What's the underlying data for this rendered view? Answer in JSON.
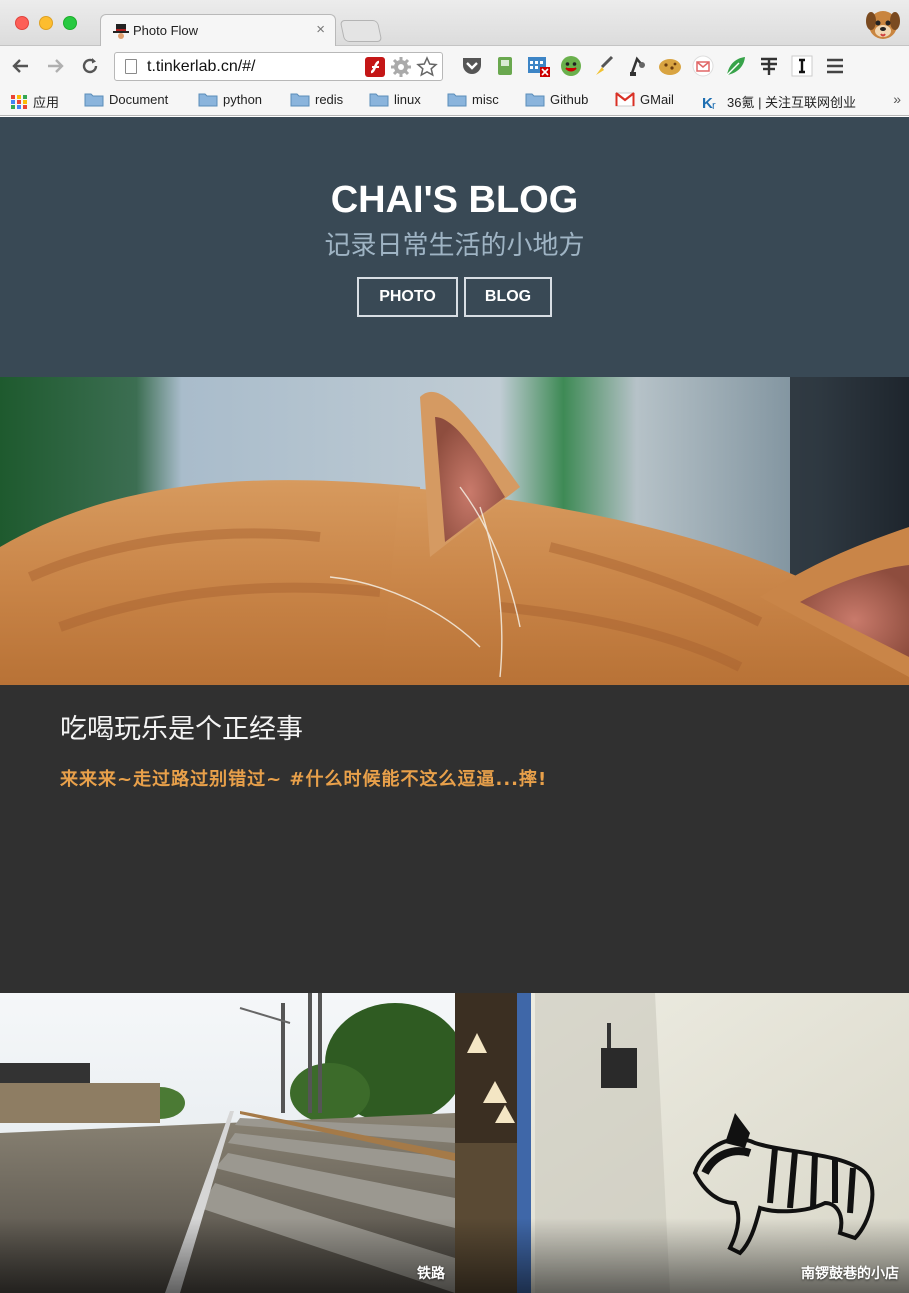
{
  "browser": {
    "tab_title": "Photo Flow",
    "tab_close": "×",
    "url": "t.tinkerlab.cn/#/",
    "bookmarks": [
      {
        "label": "应用",
        "icon": "apps-grid-icon"
      },
      {
        "label": "Document",
        "icon": "folder-icon"
      },
      {
        "label": "python",
        "icon": "folder-icon"
      },
      {
        "label": "redis",
        "icon": "folder-icon"
      },
      {
        "label": "linux",
        "icon": "folder-icon"
      },
      {
        "label": "misc",
        "icon": "folder-icon"
      },
      {
        "label": "Github",
        "icon": "folder-icon"
      },
      {
        "label": "GMail",
        "icon": "gmail-icon"
      },
      {
        "label": "36氪 | 关注互联网创业",
        "icon": "kr-icon"
      }
    ],
    "bookmarks_overflow": "»",
    "extension_icons": [
      "pocket-icon",
      "evernote-icon",
      "calendar-icon",
      "smiley-icon",
      "brush-icon",
      "robot-icon",
      "cookie-icon",
      "mail-icon",
      "leaf-icon",
      "tool-icon",
      "instapaper-icon",
      "menu-icon"
    ]
  },
  "hero": {
    "title": "CHAI'S BLOG",
    "subtitle": "记录日常生活的小地方",
    "buttons": {
      "photo": "PHOTO",
      "blog": "BLOG"
    },
    "bg_color": "#394955"
  },
  "feature": {
    "title": "吃喝玩乐是个正经事",
    "description": "来来来~走过路过别错过~ #什么时候能不这么逗逼...摔!",
    "text_bg": "#303030",
    "accent": "#e8a04a"
  },
  "gallery": [
    {
      "caption": "铁路"
    },
    {
      "caption": "南锣鼓巷的小店"
    }
  ]
}
